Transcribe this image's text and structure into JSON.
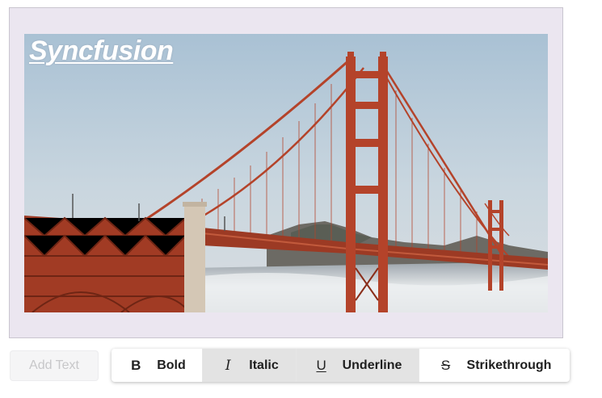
{
  "canvas": {
    "watermark_text": "Syncfusion",
    "photo_description_icon": "golden-gate-bridge-photo"
  },
  "add_text": {
    "label": "Add Text",
    "state": "disabled"
  },
  "toolbar": {
    "buttons": [
      {
        "id": "bold",
        "label": "Bold",
        "glyph": "B",
        "icon": "bold-icon",
        "active": false
      },
      {
        "id": "italic",
        "label": "Italic",
        "glyph": "I",
        "icon": "italic-icon",
        "active": true
      },
      {
        "id": "underline",
        "label": "Underline",
        "glyph": "U",
        "icon": "underline-icon",
        "active": true
      },
      {
        "id": "strikethrough",
        "label": "Strikethrough",
        "glyph": "S",
        "icon": "strikethrough-icon",
        "active": false
      }
    ]
  },
  "colors": {
    "canvas_bg": "#ebe6f0",
    "bridge": "#b4432a",
    "sky": "#b8cddc",
    "active_button": "#e3e3e3",
    "disabled_text": "#c7c7c9"
  }
}
